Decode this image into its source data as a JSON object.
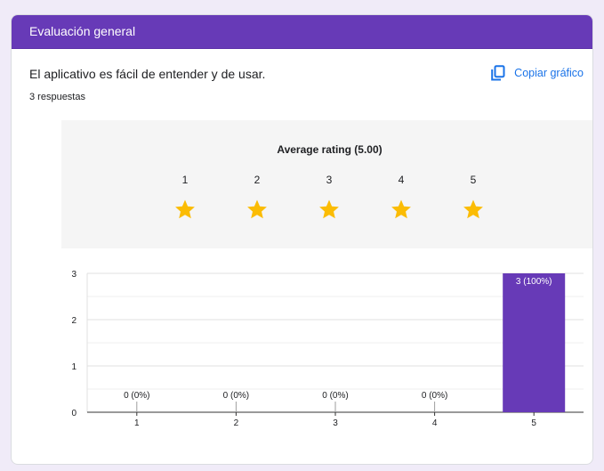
{
  "header": {
    "title": "Evaluación general"
  },
  "question": {
    "text": "El aplicativo es fácil de entender y de usar.",
    "responses": "3 respuestas"
  },
  "actions": {
    "copy_label": "Copiar gráfico"
  },
  "rating": {
    "average_label": "Average rating (5.00)",
    "average_value": 5.0,
    "scale": [
      "1",
      "2",
      "3",
      "4",
      "5"
    ],
    "filled_stars": 5,
    "star_color": "#fbbc04"
  },
  "colors": {
    "header": "#673ab7",
    "accent": "#1a73e8",
    "bar": "#673ab7"
  },
  "icons": {
    "copy": "copy-icon",
    "star": "star-icon"
  },
  "chart_data": {
    "type": "bar",
    "categories": [
      "1",
      "2",
      "3",
      "4",
      "5"
    ],
    "values": [
      0,
      0,
      0,
      0,
      3
    ],
    "data_labels": [
      "0 (0%)",
      "0 (0%)",
      "0 (0%)",
      "0 (0%)",
      "3 (100%)"
    ],
    "ylim": [
      0,
      3
    ],
    "yticks": [
      "0",
      "1",
      "2",
      "3"
    ],
    "grid": true
  }
}
